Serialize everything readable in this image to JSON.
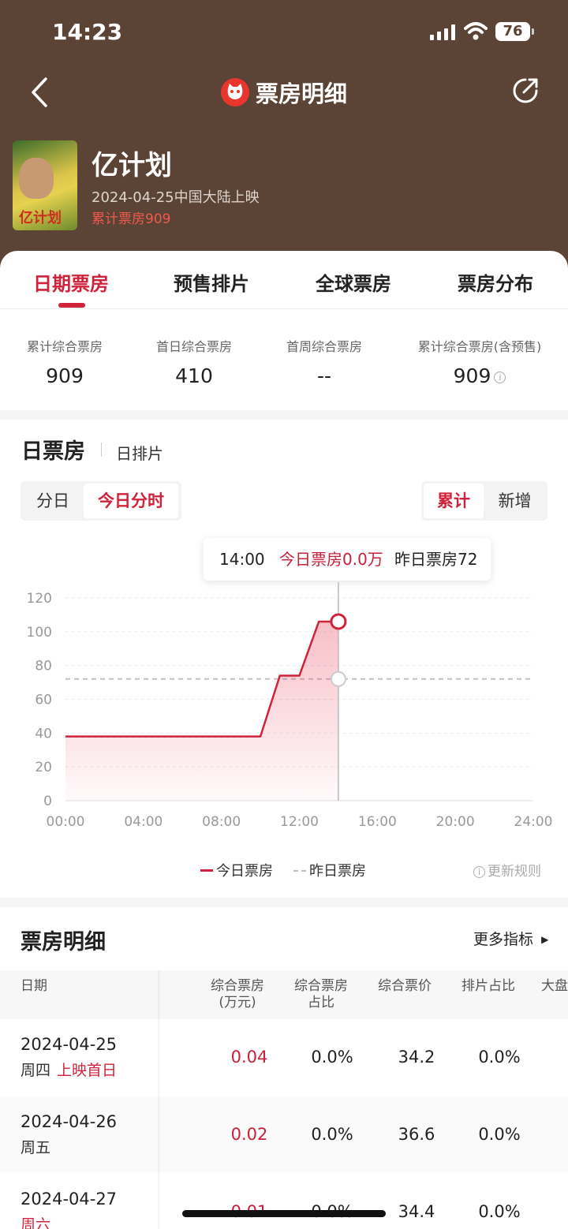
{
  "status_bar": {
    "time": "14:23",
    "battery": "76"
  },
  "header": {
    "title": "票房明细"
  },
  "movie": {
    "title": "亿计划",
    "release": "2024-04-25中国大陆上映",
    "total": "累计票房909",
    "poster_text": "亿计划"
  },
  "tabs": [
    "日期票房",
    "预售排片",
    "全球票房",
    "票房分布"
  ],
  "summary": [
    {
      "label": "累计综合票房",
      "value": "909"
    },
    {
      "label": "首日综合票房",
      "value": "410"
    },
    {
      "label": "首周综合票房",
      "value": "--"
    },
    {
      "label": "累计综合票房(含预售)",
      "value": "909"
    }
  ],
  "section": {
    "title": "日票房",
    "sub": "日排片"
  },
  "segment_left": [
    "分日",
    "今日分时"
  ],
  "segment_right": [
    "累计",
    "新增"
  ],
  "tooltip": {
    "time": "14:00",
    "today": "今日票房0.0万",
    "yesterday": "昨日票房72"
  },
  "chart_data": {
    "type": "line",
    "x_ticks": [
      "00:00",
      "04:00",
      "08:00",
      "12:00",
      "16:00",
      "20:00",
      "24:00"
    ],
    "y_ticks": [
      "0",
      "20",
      "40",
      "60",
      "80",
      "100",
      "120"
    ],
    "ylim": [
      0,
      120
    ],
    "xlim": [
      0,
      24
    ],
    "series": [
      {
        "name": "今日票房",
        "color": "#d0223a",
        "points": [
          [
            0,
            38
          ],
          [
            10,
            38
          ],
          [
            11,
            74
          ],
          [
            12,
            74
          ],
          [
            13,
            106
          ],
          [
            13.6,
            106
          ],
          [
            14,
            106
          ]
        ]
      },
      {
        "name": "昨日票房",
        "color": "#c0c0c8",
        "points": [
          [
            0,
            72
          ],
          [
            24,
            72
          ]
        ]
      }
    ],
    "cursor_x": 14
  },
  "legend": {
    "today": "今日票房",
    "yesterday": "昨日票房",
    "rules": "更新规则"
  },
  "table": {
    "title": "票房明细",
    "more": "更多指标",
    "headers": [
      "日期",
      "综合票房\n(万元)",
      "综合票房\n占比",
      "综合票价",
      "排片占比",
      "大盘"
    ],
    "rows": [
      {
        "date": "2024-04-25",
        "week": "周四",
        "tag": "上映首日",
        "box": "0.04",
        "share": "0.0%",
        "price": "34.2",
        "screen": "0.0%"
      },
      {
        "date": "2024-04-26",
        "week": "周五",
        "tag": "",
        "box": "0.02",
        "share": "0.0%",
        "price": "36.6",
        "screen": "0.0%"
      },
      {
        "date": "2024-04-27",
        "week": "周六",
        "tag": "",
        "box": "0.01",
        "share": "0.0%",
        "price": "34.4",
        "screen": "0.0%"
      }
    ]
  }
}
